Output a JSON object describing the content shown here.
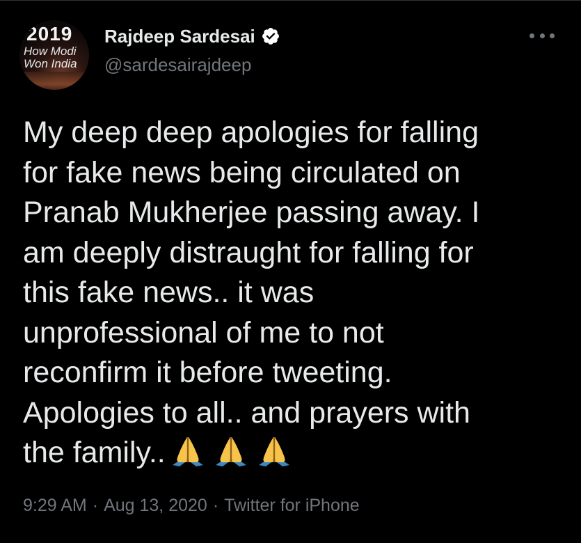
{
  "tweet": {
    "avatar": {
      "year": "2019",
      "line1": "How Modi",
      "line2": "Won India"
    },
    "author": {
      "display_name": "Rajdeep Sardesai",
      "handle": "@sardesairajdeep",
      "verified": true
    },
    "more_icon": "more-horizontal-icon",
    "body_lines": [
      "My deep deep apologies for falling",
      "for fake news being circulated on",
      "Pranab Mukherjee passing away. I",
      "am deeply distraught for falling for",
      "this fake news.. it was",
      "unprofessional of me to not",
      "reconfirm it before tweeting.",
      "Apologies to all.. and prayers with",
      "the family.."
    ],
    "emoji": [
      "folded-hands",
      "folded-hands",
      "folded-hands"
    ],
    "meta": {
      "time": "9:29 AM",
      "separator": "·",
      "date": "Aug 13, 2020",
      "source": "Twitter for iPhone"
    }
  },
  "colors": {
    "background": "#000000",
    "text_primary": "#e7e9ea",
    "text_secondary": "#71767b",
    "verified": "#ffffff",
    "emoji_hands": "#f7c34a",
    "emoji_sleeve": "#3b88c3"
  }
}
